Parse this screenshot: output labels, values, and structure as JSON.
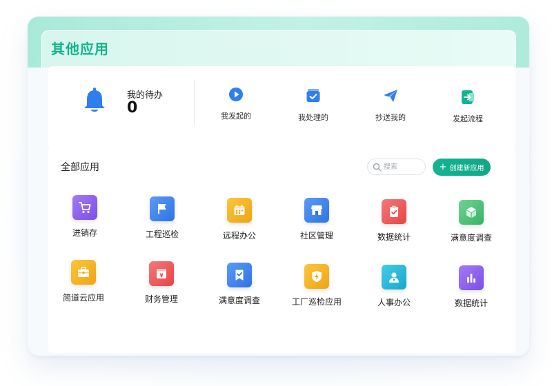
{
  "title": "其他应用",
  "todo": {
    "label": "我的待办",
    "count": "0"
  },
  "quick_actions": [
    {
      "label": "我发起的",
      "icon": "play-circle-icon",
      "color": "#2f7ef0"
    },
    {
      "label": "我处理的",
      "icon": "check-inbox-icon",
      "color": "#2f7ef0"
    },
    {
      "label": "抄送我的",
      "icon": "paper-plane-icon",
      "color": "#2f7ef0"
    },
    {
      "label": "发起流程",
      "icon": "exit-arrow-icon",
      "color": "#14b491"
    }
  ],
  "section": {
    "title": "全部应用",
    "search_placeholder": "搜索",
    "create_label": "创建新应用"
  },
  "apps": [
    {
      "name": "进销存",
      "icon": "shopping-cart-icon",
      "color": "#8e5cf0"
    },
    {
      "name": "工程巡检",
      "icon": "flag-icon",
      "color": "#3c86f0"
    },
    {
      "name": "远程办公",
      "icon": "calendar-icon",
      "color": "#f5b31f"
    },
    {
      "name": "社区管理",
      "icon": "storefront-icon",
      "color": "#3c86f0"
    },
    {
      "name": "数据统计",
      "icon": "clipboard-check-icon",
      "color": "#ef5a5a"
    },
    {
      "name": "满意度调查",
      "icon": "cube-icon",
      "color": "#4cc07a"
    },
    {
      "name": "简道云应用",
      "icon": "briefcase-icon",
      "color": "#f5b31f"
    },
    {
      "name": "财务管理",
      "icon": "yen-box-icon",
      "color": "#ef5a5a"
    },
    {
      "name": "满意度调查",
      "icon": "bookmark-check-icon",
      "color": "#3c86f0"
    },
    {
      "name": "工厂巡检应用",
      "icon": "shield-bolt-icon",
      "color": "#f5b31f"
    },
    {
      "name": "人事办公",
      "icon": "person-badge-icon",
      "color": "#1fb8d8"
    },
    {
      "name": "数据统计",
      "icon": "bar-chart-icon",
      "color": "#8e5cf0"
    }
  ]
}
